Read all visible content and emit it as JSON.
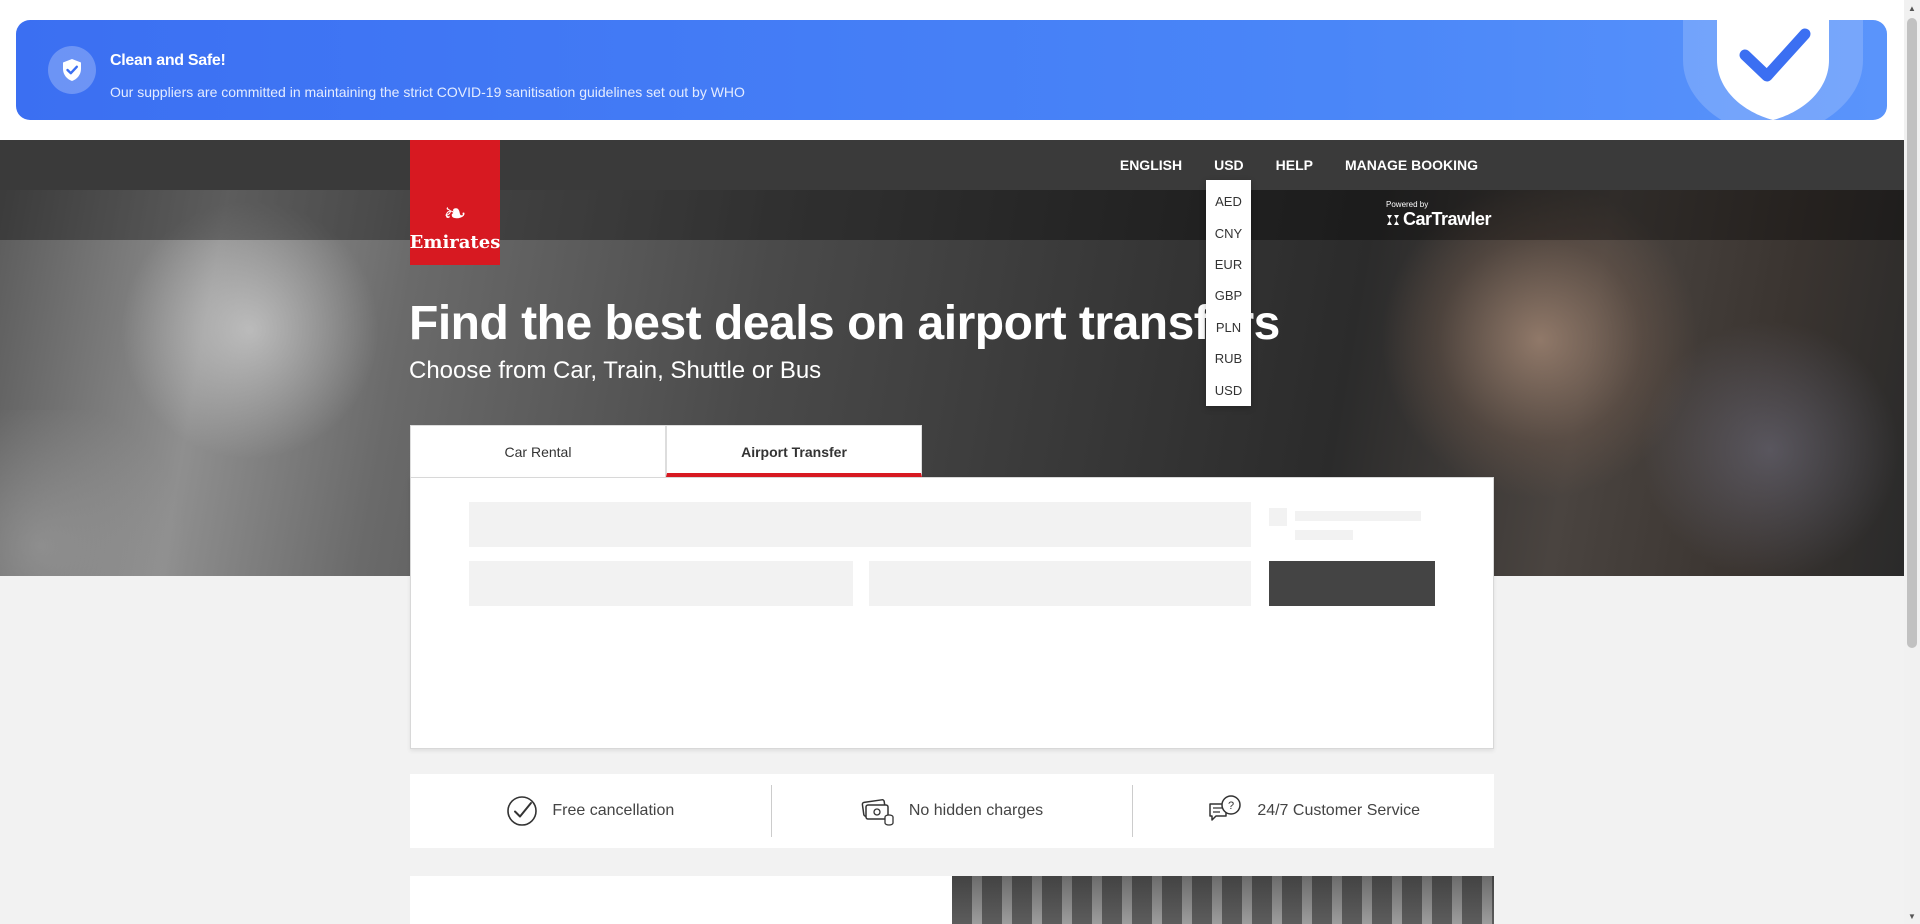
{
  "banner": {
    "title": "Clean and Safe!",
    "subtitle": "Our suppliers are committed in maintaining the strict COVID-19 sanitisation guidelines set out by WHO"
  },
  "nav": {
    "language": "ENGLISH",
    "currency": "USD",
    "help": "HELP",
    "manage_booking": "MANAGE BOOKING"
  },
  "logo": {
    "text": "Emirates"
  },
  "powered": {
    "small": "Powered by",
    "brand": "CarTrawler"
  },
  "hero": {
    "title": "Find the best deals on airport transfers",
    "subtitle": "Choose from Car, Train, Shuttle or Bus"
  },
  "currency_dropdown": {
    "options": [
      "AED",
      "CNY",
      "EUR",
      "GBP",
      "PLN",
      "RUB",
      "USD"
    ]
  },
  "tabs": [
    {
      "label": "Car Rental",
      "active": false
    },
    {
      "label": "Airport Transfer",
      "active": true
    }
  ],
  "features": [
    {
      "label": "Free cancellation",
      "icon": "check-circle-icon"
    },
    {
      "label": "No hidden charges",
      "icon": "money-icon"
    },
    {
      "label": "24/7 Customer Service",
      "icon": "support-chat-icon"
    }
  ],
  "colors": {
    "brand_red": "#d71921",
    "banner_blue": "#3b6ff2",
    "nav_dark": "#3a3a3a"
  }
}
